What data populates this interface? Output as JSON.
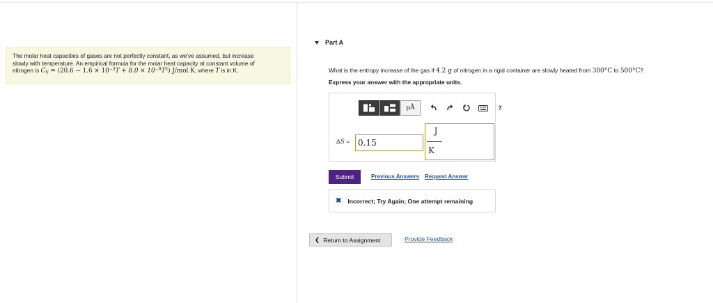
{
  "intro": {
    "text_line1": "The molar heat capacities of gases are not perfectly constant, as we've assumed, but increase",
    "text_line2": "slowly with temperature. An empirical formula for the molar heat capacity at constant volume of",
    "text_prefix": "nitrogen is ",
    "cv_symbol": "C",
    "cv_sub": "V",
    "formula_a": " = (20.6 − 1.6 × 10",
    "exp1": "−3",
    "formula_b": "T + 8.0 × 10",
    "exp2": "−6",
    "formula_c": "T",
    "exp3": "2",
    "formula_d": ") J/mol K",
    "text_mid": ", where ",
    "t_symbol": "T",
    "text_end": " is in K."
  },
  "part": {
    "label": "Part A"
  },
  "question": {
    "before_mass": "What is the entropy increase of the gas if ",
    "mass": "4.2 g",
    "mid": " of nitrogen in a rigid container are slowly heated from ",
    "t1": "300°C",
    "to": " to ",
    "t2": "500°C",
    "end": "?"
  },
  "instruction": "Express your answer with the appropriate units.",
  "toolbar": {
    "units_label": "μÅ",
    "help_label": "?"
  },
  "answer": {
    "label_delta": "Δ",
    "label_symbol": "S",
    "label_eq": " =",
    "value": "0.15",
    "unit_numerator": "J",
    "unit_denominator": "K"
  },
  "actions": {
    "submit": "Submit",
    "previous_answers": "Previous Answers",
    "request_answer": "Request Answer"
  },
  "feedback": {
    "icon": "✖",
    "message": "Incorrect; Try Again; One attempt remaining"
  },
  "footer": {
    "return_label": "Return to Assignment",
    "return_icon": "❮",
    "feedback_link": "Provide Feedback"
  }
}
